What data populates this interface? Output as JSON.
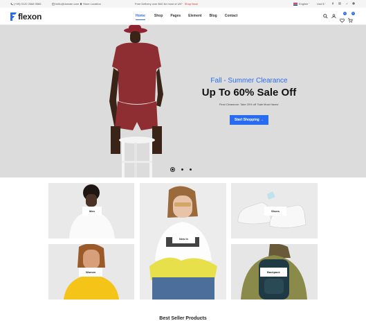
{
  "topbar": {
    "phone": "(+99) 0120 2568 9565",
    "email": "hello@domain.com",
    "store": "Store Location",
    "promo": "Free Delivery over $40 for most of UK*",
    "promo_link": "Shop Now!",
    "language": "English",
    "currency": "Usd $"
  },
  "header": {
    "logo": "flexon",
    "nav": [
      "Home",
      "Shop",
      "Pages",
      "Element",
      "Blog",
      "Contact"
    ],
    "wishlist_count": "0",
    "cart_count": "0"
  },
  "hero": {
    "subtitle": "Fall - Summer Clearance",
    "title": "Up To 60% Sale Off",
    "description": "Final Clearance: Take 20% off 'Sale Must Haves'",
    "button": "Start Shopping  →"
  },
  "categories": [
    "Men",
    "New In",
    "Shoes",
    "Women",
    "Backpack"
  ],
  "section": {
    "title": "Best Seller Products"
  },
  "colors": {
    "accent": "#2a6cf0",
    "promo": "#e0312e"
  }
}
